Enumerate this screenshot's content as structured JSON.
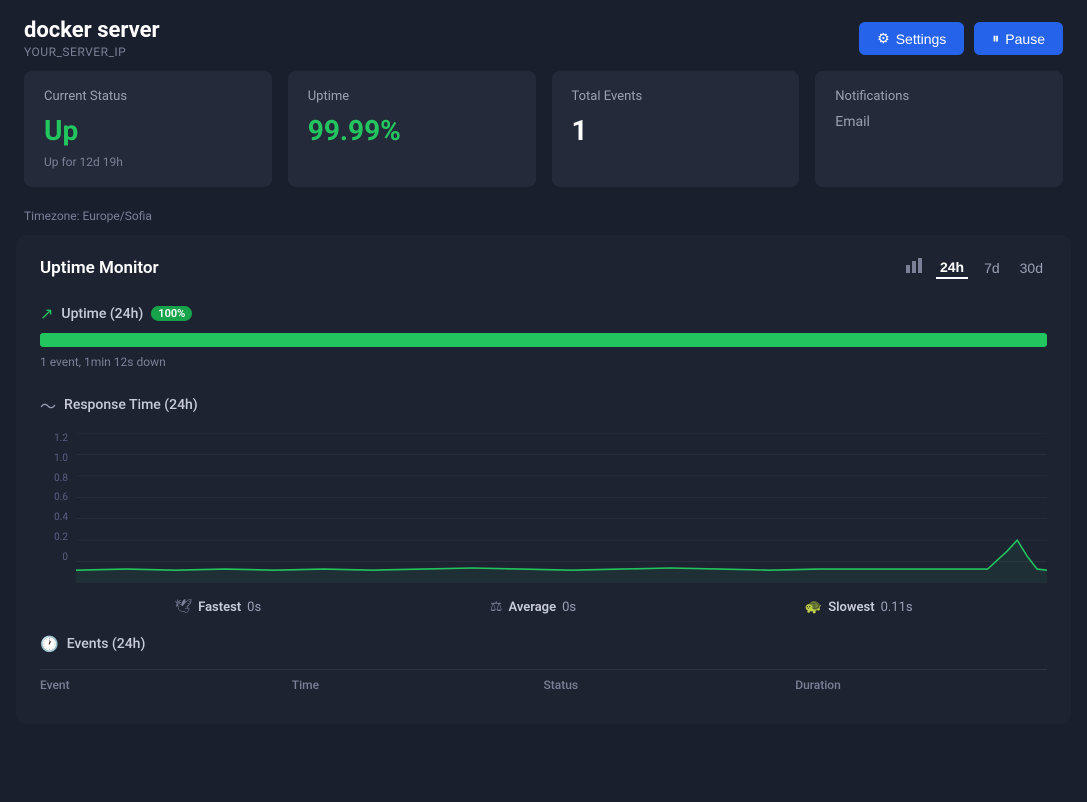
{
  "header": {
    "server_name": "docker server",
    "server_ip": "YOUR_SERVER_IP",
    "settings_label": "Settings",
    "pause_label": "Pause"
  },
  "cards": {
    "current_status": {
      "label": "Current Status",
      "value": "Up",
      "sub": "Up for 12d 19h"
    },
    "uptime": {
      "label": "Uptime",
      "value": "99.99%"
    },
    "total_events": {
      "label": "Total Events",
      "value": "1"
    },
    "notifications": {
      "label": "Notifications",
      "value": "Email"
    }
  },
  "timezone": {
    "label": "Timezone: Europe/Sofia"
  },
  "monitor": {
    "title": "Uptime Monitor",
    "time_options": [
      "24h",
      "7d",
      "30d"
    ],
    "active_time": "24h",
    "uptime_section": {
      "title": "Uptime (24h)",
      "badge": "100%",
      "bar_percent": 100,
      "sub": "1 event, 1min 12s down"
    },
    "response_section": {
      "title": "Response Time (24h)",
      "y_labels": [
        "1.2",
        "1.0",
        "0.8",
        "0.6",
        "0.4",
        "0.2",
        "0"
      ]
    },
    "stats": {
      "fastest_label": "Fastest",
      "fastest_value": "0s",
      "average_label": "Average",
      "average_value": "0s",
      "slowest_label": "Slowest",
      "slowest_value": "0.11s"
    },
    "events_section": {
      "title": "Events (24h)",
      "columns": [
        "Event",
        "Time",
        "Status",
        "Duration"
      ]
    }
  }
}
